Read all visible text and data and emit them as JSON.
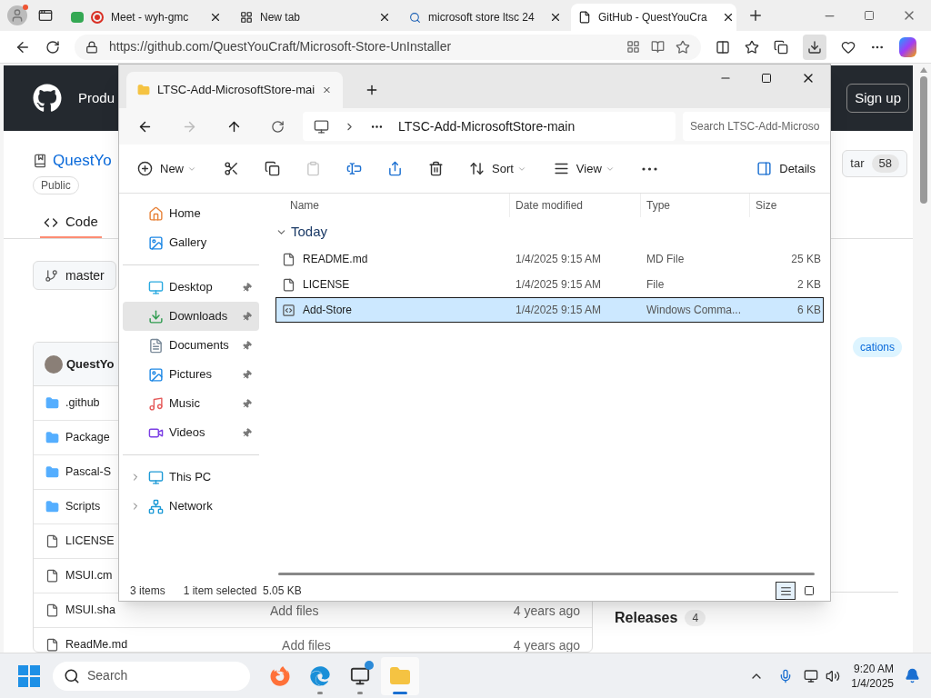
{
  "browser": {
    "tabs": [
      {
        "kind": "meet",
        "title": "Meet - wyh-gmc",
        "selected": false
      },
      {
        "kind": "newtab",
        "title": "New tab",
        "selected": false
      },
      {
        "kind": "search",
        "title": "microsoft store ltsc 24",
        "selected": false
      },
      {
        "kind": "page",
        "title": "GitHub - QuestYouCra",
        "selected": true
      }
    ],
    "url": "https://github.com/QuestYouCraft/Microsoft-Store-UnInstaller",
    "downloads_active": true
  },
  "github": {
    "header": {
      "menu": "Produ",
      "signup": "Sign up"
    },
    "repo": {
      "name": "QuestYo",
      "visibility": "Public",
      "star_label": "tar",
      "star_count": "58"
    },
    "tabs": [
      {
        "label": "Code",
        "selected": true
      }
    ],
    "branch": "master",
    "owner": "QuestYo",
    "files": [
      {
        "kind": "folder",
        "name": ".github"
      },
      {
        "kind": "folder",
        "name": "Package"
      },
      {
        "kind": "folder",
        "name": "Pascal-S"
      },
      {
        "kind": "folder",
        "name": "Scripts"
      },
      {
        "kind": "file",
        "name": "LICENSE"
      },
      {
        "kind": "file",
        "name": "MSUI.cm"
      },
      {
        "kind": "file",
        "name": "MSUI.sha",
        "message": "Add files",
        "time": "4 years ago"
      },
      {
        "kind": "file",
        "name": "ReadMe.md",
        "message": "Add files",
        "time": "4 years ago"
      }
    ],
    "topic": "cations",
    "releases": {
      "label": "Releases",
      "count": "4"
    }
  },
  "explorer": {
    "tab_title": "LTSC-Add-MicrosoftStore-mai",
    "breadcrumb": "LTSC-Add-MicrosoftStore-main",
    "search_placeholder": "Search LTSC-Add-Microso",
    "toolbar": [
      {
        "label": "New",
        "disabled": false
      },
      {
        "disabled": false
      },
      {
        "disabled": false
      },
      {
        "disabled": true
      },
      {
        "disabled": false
      },
      {
        "disabled": false
      },
      {
        "disabled": false
      },
      {
        "label": "Sort",
        "disabled": false
      },
      {
        "label": "View",
        "disabled": false
      },
      {
        "disabled": false
      }
    ],
    "details": "Details",
    "nav": [
      [
        {
          "label": "Home",
          "selected": false,
          "pinned": false
        },
        {
          "label": "Gallery",
          "selected": false,
          "pinned": false
        }
      ],
      [
        {
          "label": "Desktop",
          "selected": false,
          "pinned": true
        },
        {
          "label": "Downloads",
          "selected": true,
          "pinned": true
        },
        {
          "label": "Documents",
          "selected": false,
          "pinned": true
        },
        {
          "label": "Pictures",
          "selected": false,
          "pinned": true
        },
        {
          "label": "Music",
          "selected": false,
          "pinned": true
        },
        {
          "label": "Videos",
          "selected": false,
          "pinned": true
        }
      ],
      [
        {
          "label": "This PC",
          "selected": false,
          "expanded": false
        },
        {
          "label": "Network",
          "selected": false,
          "expanded": false
        }
      ]
    ],
    "columns": [
      "Name",
      "Date modified",
      "Type",
      "Size"
    ],
    "group": {
      "label": "Today",
      "expanded": true
    },
    "files": [
      {
        "kind": "document",
        "name": "README.md",
        "date": "1/4/2025 9:15 AM",
        "type": "MD File",
        "size": "25 KB",
        "selected": false
      },
      {
        "kind": "document",
        "name": "LICENSE",
        "date": "1/4/2025 9:15 AM",
        "type": "File",
        "size": "2 KB",
        "selected": false
      },
      {
        "kind": "script",
        "name": "Add-Store",
        "date": "1/4/2025 9:15 AM",
        "type": "Windows Comma...",
        "size": "6 KB",
        "selected": true
      }
    ],
    "status": {
      "count": "3 items",
      "selection": "1 item selected",
      "size": "5.05 KB"
    },
    "view": [
      {
        "selected": true
      },
      {
        "selected": false
      }
    ]
  },
  "taskbar": {
    "search": "Search",
    "apps": [
      {
        "running": false,
        "active": false
      },
      {
        "running": true,
        "active": false
      },
      {
        "running": true,
        "active": false,
        "badge": true
      },
      {
        "running": true,
        "active": true
      }
    ],
    "time": "9:20 AM",
    "date": "1/4/2025"
  }
}
